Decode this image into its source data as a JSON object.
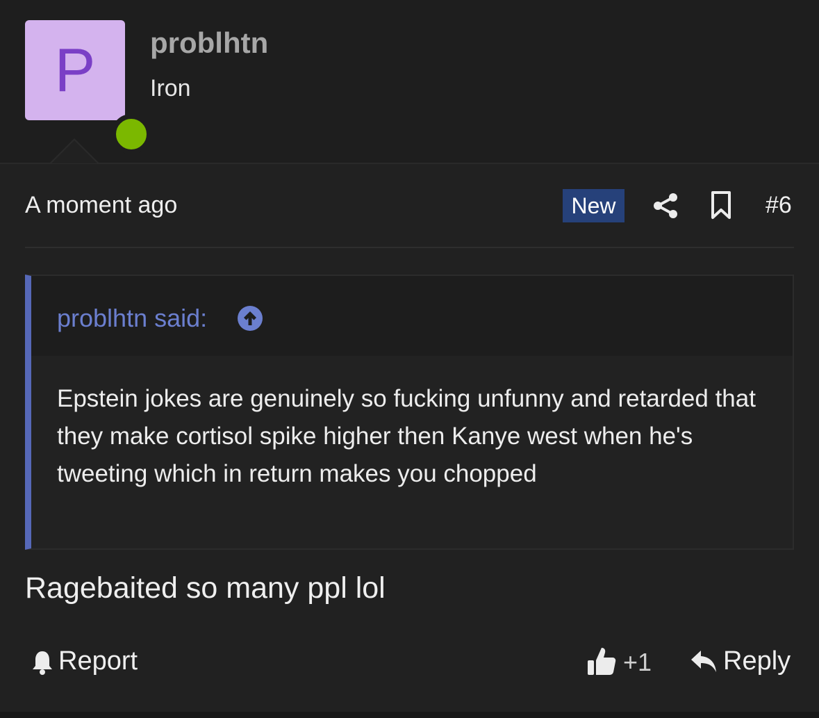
{
  "author": {
    "initial": "P",
    "username": "problhtn",
    "title": "Iron",
    "status": "online",
    "avatar_color": "#d4b3ee",
    "initial_color": "#7a3fc6"
  },
  "post": {
    "timestamp": "A moment ago",
    "badge": "New",
    "number": "#6",
    "quote": {
      "author_label": "problhtn said:",
      "text": "Epstein jokes are genuinely so fucking unfunny and retarded that they make cortisol spike higher then Kanye west when he's tweeting which in return makes you chopped"
    },
    "message": "Ragebaited so many ppl lol"
  },
  "actions": {
    "report_label": "Report",
    "like_count": "+1",
    "reply_label": "Reply"
  },
  "icons": [
    "share-icon",
    "bookmark-icon",
    "arrow-up-circle-icon",
    "bell-icon",
    "thumbs-up-icon",
    "reply-icon"
  ],
  "colors": {
    "accent": "#5668b8",
    "badge_bg": "#26417a",
    "online": "#7bb800",
    "background": "#212121"
  }
}
